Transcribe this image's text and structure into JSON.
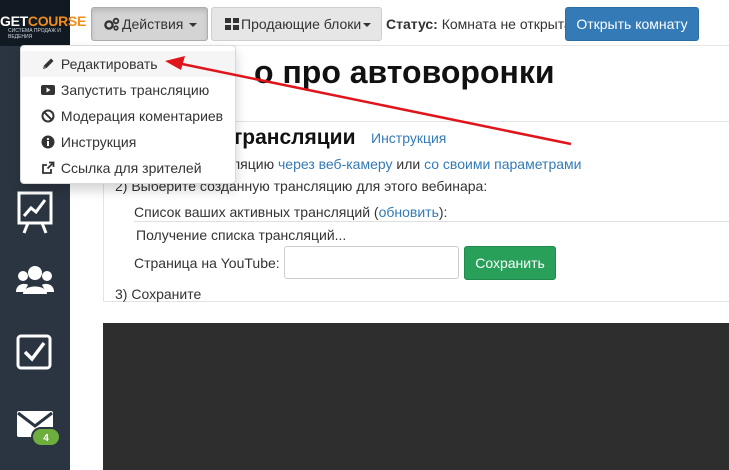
{
  "logo": {
    "main_a": "GET",
    "main_b": "COURSE",
    "sub": "СИСТЕМА ПРОДАЖ И ВЕДЕНИЯ"
  },
  "sidebar": {
    "icons": [
      "chart-presentation-icon",
      "users-icon",
      "checkbox-icon",
      "mail-icon"
    ],
    "mail_badge": "4"
  },
  "toolbar": {
    "actions_label": "Действия",
    "blocks_label": "Продающие блоки",
    "status_label": "Статус:",
    "status_value": "Комната не открыта",
    "open_room_label": "Открыть комнату"
  },
  "page": {
    "title": "о про автоворонки"
  },
  "broadcast": {
    "section_title": "трансляции",
    "instruction_link": "Инструкция",
    "step1_prefix": "ляцию",
    "step1_link1": "через веб-камеру",
    "step1_mid": "или",
    "step1_link2": "со своими параметрами",
    "step2": "2) Выберите созданную трансляцию для этого вебинара:",
    "active_list_prefix": "Список ваших активных трансляций (",
    "active_list_link": "обновить",
    "active_list_suffix": "):",
    "loading": "Получение списка трансляций...",
    "youtube_label": "Страница на YouTube:",
    "youtube_value": "",
    "save_label": "Сохранить",
    "step3": "3) Сохраните"
  },
  "dropdown": {
    "items": [
      {
        "label": "Редактировать",
        "icon": "pencil-icon"
      },
      {
        "label": "Запустить трансляцию",
        "icon": "youtube-icon"
      },
      {
        "label": "Модерация коментариев",
        "icon": "ban-icon"
      },
      {
        "label": "Инструкция",
        "icon": "info-icon"
      },
      {
        "label": "Ссылка для зрителей",
        "icon": "external-link-icon"
      }
    ]
  },
  "colors": {
    "sidebar": "#2b3541",
    "primary": "#337ab7",
    "success": "#28a05a",
    "annotation_arrow": "#e0151b",
    "player": "#2e2e2e"
  }
}
